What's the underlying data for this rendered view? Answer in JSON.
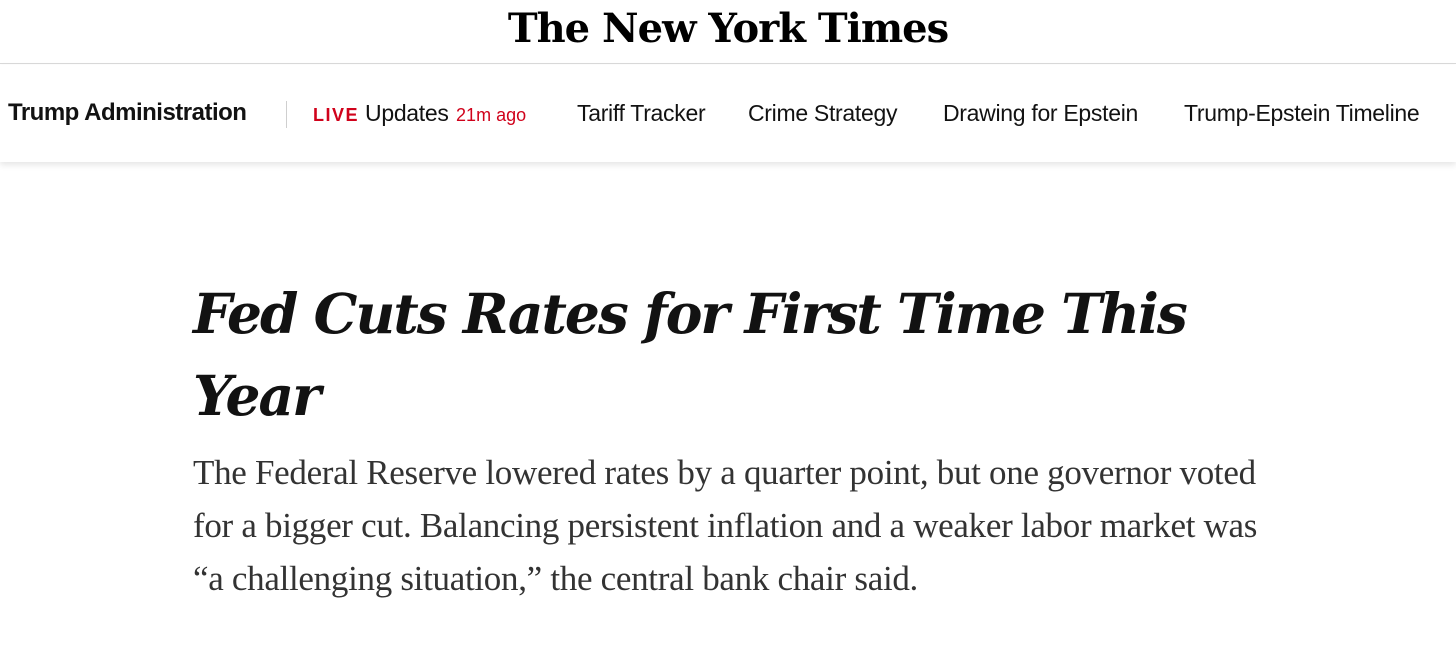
{
  "masthead": {
    "logo_text": "The New York Times"
  },
  "nav": {
    "section_label": "Trump Administration",
    "live": {
      "badge": "LIVE",
      "label": "Updates",
      "time_ago": "21m ago",
      "badge_color": "#d0021b"
    },
    "links": [
      {
        "label": "Tariff Tracker"
      },
      {
        "label": "Crime Strategy"
      },
      {
        "label": "Drawing for Epstein"
      },
      {
        "label": "Trump-Epstein Timeline"
      }
    ]
  },
  "article": {
    "headline": "Fed Cuts Rates for First Time This Year",
    "summary": "The Federal Reserve lowered rates by a quarter point, but one governor voted for a bigger cut. Balancing persistent inflation and a weaker labor market was “a challenging situation,” the central bank chair said."
  }
}
